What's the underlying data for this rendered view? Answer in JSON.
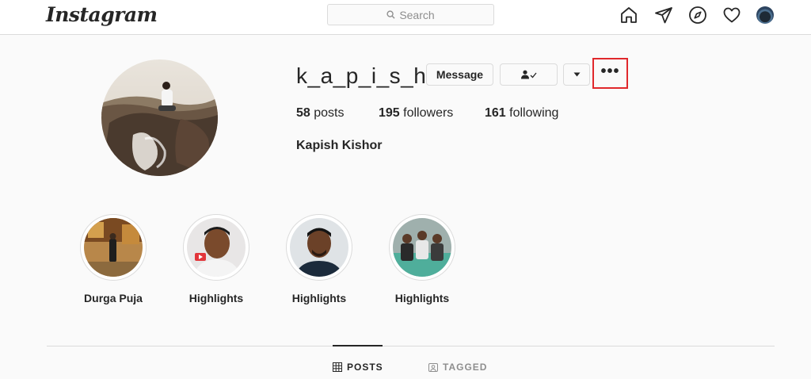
{
  "nav": {
    "logo": "Instagram",
    "search_placeholder": "Search",
    "icons": [
      "home-icon",
      "direct-icon",
      "explore-icon",
      "activity-heart-icon",
      "profile-avatar"
    ]
  },
  "profile": {
    "username": "k_a_p_i_s_h",
    "buttons": {
      "message": "Message",
      "following_icon": "person-check-icon",
      "dropdown_icon": "chevron-down-icon",
      "more": "•••"
    },
    "stats": {
      "posts_count": "58",
      "posts_label": "posts",
      "followers_count": "195",
      "followers_label": "followers",
      "following_count": "161",
      "following_label": "following"
    },
    "full_name": "Kapish Kishor"
  },
  "highlights": [
    {
      "label": "Durga Puja"
    },
    {
      "label": "Highlights"
    },
    {
      "label": "Highlights"
    },
    {
      "label": "Highlights"
    }
  ],
  "tabs": {
    "posts": "POSTS",
    "tagged": "TAGGED"
  },
  "colors": {
    "accent_highlight_box": "#e0282c",
    "border": "#dbdbdb",
    "muted_text": "#8e8e8e"
  }
}
